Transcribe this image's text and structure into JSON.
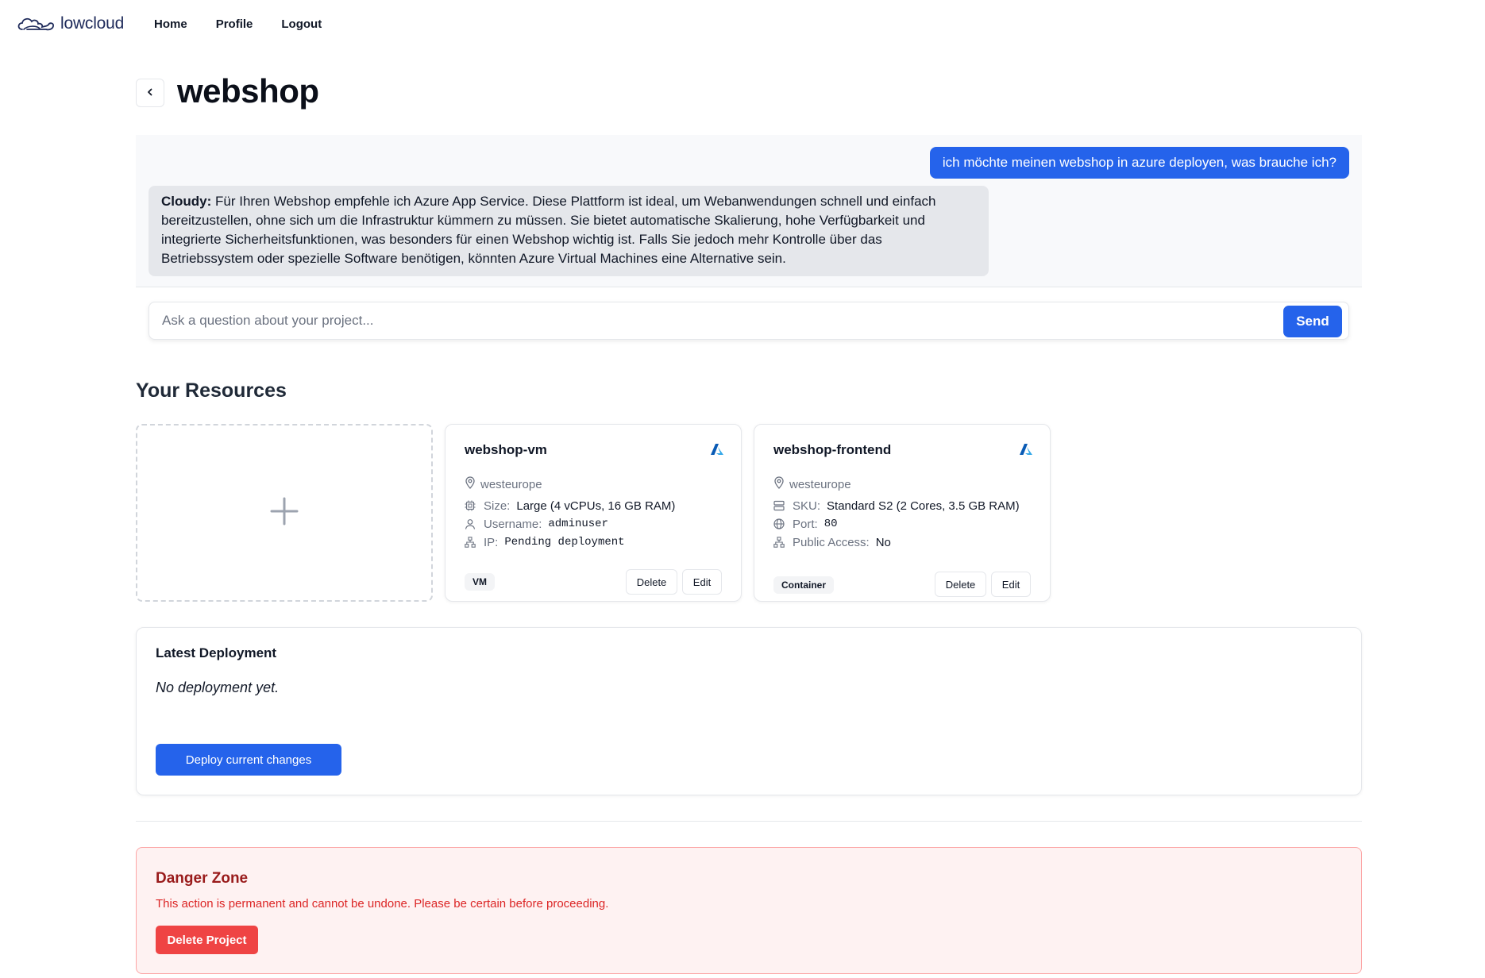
{
  "nav": {
    "logo_text": "lowcloud",
    "links": [
      "Home",
      "Profile",
      "Logout"
    ]
  },
  "page": {
    "title": "webshop"
  },
  "chat": {
    "user_message": "ich möchte meinen webshop in azure deployen, was brauche ich?",
    "bot_name": "Cloudy:",
    "bot_message": " Für Ihren Webshop empfehle ich Azure App Service. Diese Plattform ist ideal, um Webanwendungen schnell und einfach bereitzustellen, ohne sich um die Infrastruktur kümmern zu müssen. Sie bietet automatische Skalierung, hohe Verfügbarkeit und integrierte Sicherheitsfunktionen, was besonders für einen Webshop wichtig ist. Falls Sie jedoch mehr Kontrolle über das Betriebssystem oder spezielle Software benötigen, könnten Azure Virtual Machines eine Alternative sein.",
    "input_placeholder": "Ask a question about your project...",
    "input_value": "",
    "send_label": "Send"
  },
  "resources": {
    "title": "Your Resources",
    "cards": [
      {
        "name": "webshop-vm",
        "location": "westeurope",
        "rows": [
          {
            "icon": "cpu-icon",
            "label": "Size:",
            "value": "Large (4 vCPUs, 16 GB RAM)",
            "mono": false
          },
          {
            "icon": "user-icon",
            "label": "Username:",
            "value": "adminuser",
            "mono": true
          },
          {
            "icon": "network-icon",
            "label": "IP:",
            "value": "Pending deployment",
            "mono": true
          }
        ],
        "tag": "VM",
        "delete_label": "Delete",
        "edit_label": "Edit"
      },
      {
        "name": "webshop-frontend",
        "location": "westeurope",
        "rows": [
          {
            "icon": "server-icon",
            "label": "SKU:",
            "value": "Standard S2 (2 Cores, 3.5 GB RAM)",
            "mono": false
          },
          {
            "icon": "globe-icon",
            "label": "Port:",
            "value": "80",
            "mono": true
          },
          {
            "icon": "network-icon",
            "label": "Public Access:",
            "value": "No",
            "mono": false
          }
        ],
        "tag": "Container",
        "delete_label": "Delete",
        "edit_label": "Edit"
      }
    ]
  },
  "deployment": {
    "title": "Latest Deployment",
    "status": "No deployment yet.",
    "button_label": "Deploy current changes"
  },
  "danger": {
    "title": "Danger Zone",
    "text": "This action is permanent and cannot be undone. Please be certain before proceeding.",
    "button_label": "Delete Project"
  },
  "colors": {
    "primary": "#2563eb",
    "danger": "#ef4444",
    "danger_bg": "#fef2f2",
    "azure": "#0078d4"
  }
}
